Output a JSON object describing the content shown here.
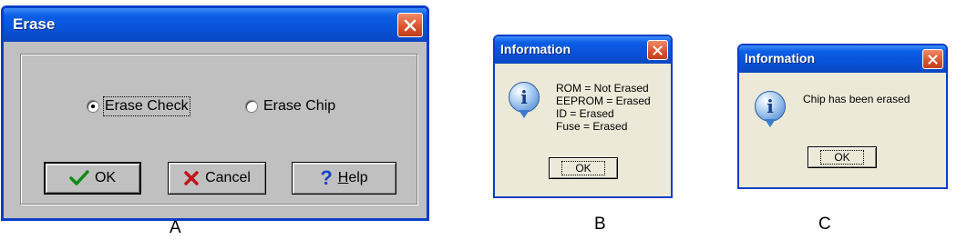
{
  "dialog_a": {
    "title": "Erase",
    "options": [
      {
        "label": "Erase Check",
        "selected": true
      },
      {
        "label": "Erase Chip",
        "selected": false
      }
    ],
    "buttons": {
      "ok": "OK",
      "cancel": "Cancel",
      "help_mnemonic": "H",
      "help_rest": "elp"
    },
    "caption": "A"
  },
  "dialog_b": {
    "title": "Information",
    "lines": [
      "ROM = Not Erased",
      "EEPROM = Erased",
      "ID = Erased",
      "Fuse = Erased"
    ],
    "ok": "OK",
    "caption": "B"
  },
  "dialog_c": {
    "title": "Information",
    "message": "Chip has been erased",
    "ok": "OK",
    "caption": "C"
  },
  "colors": {
    "titlebar": "#0853d8",
    "close": "#d9512a",
    "classic_face": "#c0c0c0",
    "xp_face": "#ece9d8"
  },
  "icons": [
    "close-icon",
    "checkmark-icon",
    "x-icon",
    "question-icon",
    "info-icon"
  ]
}
